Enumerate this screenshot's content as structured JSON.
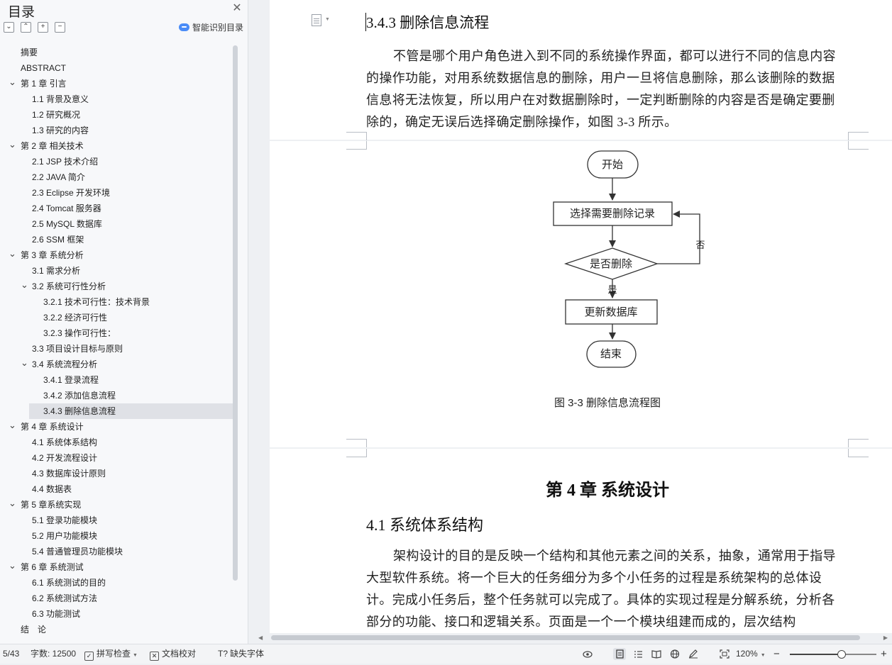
{
  "sidebar": {
    "title": "目录",
    "ai_toc_label": "智能识别目录",
    "toc": [
      {
        "label": "摘要",
        "level": 0,
        "expandable": false
      },
      {
        "label": "ABSTRACT",
        "level": 0,
        "expandable": false
      },
      {
        "label": "第 1 章  引言",
        "level": 0,
        "expandable": true
      },
      {
        "label": "1.1  背景及意义",
        "level": 1,
        "expandable": false
      },
      {
        "label": "1.2  研究概况",
        "level": 1,
        "expandable": false
      },
      {
        "label": "1.3  研究的内容",
        "level": 1,
        "expandable": false
      },
      {
        "label": "第 2 章  相关技术",
        "level": 0,
        "expandable": true
      },
      {
        "label": "2.1 JSP 技术介绍",
        "level": 1,
        "expandable": false
      },
      {
        "label": "2.2 JAVA 简介",
        "level": 1,
        "expandable": false
      },
      {
        "label": "2.3 Eclipse 开发环境",
        "level": 1,
        "expandable": false
      },
      {
        "label": "2.4 Tomcat 服务器",
        "level": 1,
        "expandable": false
      },
      {
        "label": "2.5 MySQL 数据库",
        "level": 1,
        "expandable": false
      },
      {
        "label": "2.6 SSM 框架",
        "level": 1,
        "expandable": false
      },
      {
        "label": "第 3 章  系统分析",
        "level": 0,
        "expandable": true
      },
      {
        "label": "3.1  需求分析",
        "level": 1,
        "expandable": false
      },
      {
        "label": "3.2  系统可行性分析",
        "level": 1,
        "expandable": true
      },
      {
        "label": "3.2.1 技术可行性：技术背景",
        "level": 2,
        "expandable": false
      },
      {
        "label": "3.2.2 经济可行性",
        "level": 2,
        "expandable": false
      },
      {
        "label": "3.2.3 操作可行性：",
        "level": 2,
        "expandable": false
      },
      {
        "label": "3.3  项目设计目标与原则",
        "level": 1,
        "expandable": false
      },
      {
        "label": "3.4  系统流程分析",
        "level": 1,
        "expandable": true
      },
      {
        "label": "3.4.1 登录流程",
        "level": 2,
        "expandable": false
      },
      {
        "label": "3.4.2 添加信息流程",
        "level": 2,
        "expandable": false
      },
      {
        "label": "3.4.3 删除信息流程",
        "level": 2,
        "expandable": false,
        "selected": true
      },
      {
        "label": "第 4 章  系统设计",
        "level": 0,
        "expandable": true
      },
      {
        "label": "4.1  系统体系结构",
        "level": 1,
        "expandable": false
      },
      {
        "label": "4.2  开发流程设计",
        "level": 1,
        "expandable": false
      },
      {
        "label": "4.3  数据库设计原则",
        "level": 1,
        "expandable": false
      },
      {
        "label": "4.4  数据表",
        "level": 1,
        "expandable": false
      },
      {
        "label": "第 5 章系统实现",
        "level": 0,
        "expandable": true
      },
      {
        "label": "5.1  登录功能模块",
        "level": 1,
        "expandable": false
      },
      {
        "label": "5.2  用户功能模块",
        "level": 1,
        "expandable": false
      },
      {
        "label": "5.4  普通管理员功能模块",
        "level": 1,
        "expandable": false
      },
      {
        "label": "第 6 章  系统测试",
        "level": 0,
        "expandable": true
      },
      {
        "label": "6.1  系统测试的目的",
        "level": 1,
        "expandable": false
      },
      {
        "label": "6.2  系统测试方法",
        "level": 1,
        "expandable": false
      },
      {
        "label": "6.3  功能测试",
        "level": 1,
        "expandable": false
      },
      {
        "label": "结　论",
        "level": 0,
        "expandable": false
      }
    ]
  },
  "document": {
    "section_heading": "3.4.3 删除信息流程",
    "paragraph_1": "不管是哪个用户角色进入到不同的系统操作界面，都可以进行不同的信息内容的操作功能，对用系统数据信息的删除，用户一旦将信息删除，那么该删除的数据信息将无法恢复，所以用户在对数据删除时，一定判断删除的内容是否是确定要删除的，确定无误后选择确定删除操作，如图 3-3 所示。",
    "flowchart": {
      "start": "开始",
      "select": "选择需要删除记录",
      "decision": "是否删除",
      "no_label": "否",
      "yes_label": "是",
      "update": "更新数据库",
      "end": "结束"
    },
    "figure_caption": "图 3-3 删除信息流程图",
    "chapter_heading": "第 4 章  系统设计",
    "subsection_heading": "4.1  系统体系结构",
    "paragraph_2": "架构设计的目的是反映一个结构和其他元素之间的关系，抽象，通常用于指导大型软件系统。将一个巨大的任务细分为多个小任务的过程是系统架构的总体设计。完成小任务后，整个任务就可以完成了。具体的实现过程是分解系统，分析各部分的功能、接口和逻辑关系。页面是一个一个模块组建而成的，层次结构"
  },
  "status_bar": {
    "page": "5/43",
    "word_count": "字数: 12500",
    "spell_check": "拼写检查",
    "doc_proof": "文档校对",
    "missing_fonts": "缺失字体",
    "zoom": "120%",
    "zoom_fraction": 0.6
  }
}
